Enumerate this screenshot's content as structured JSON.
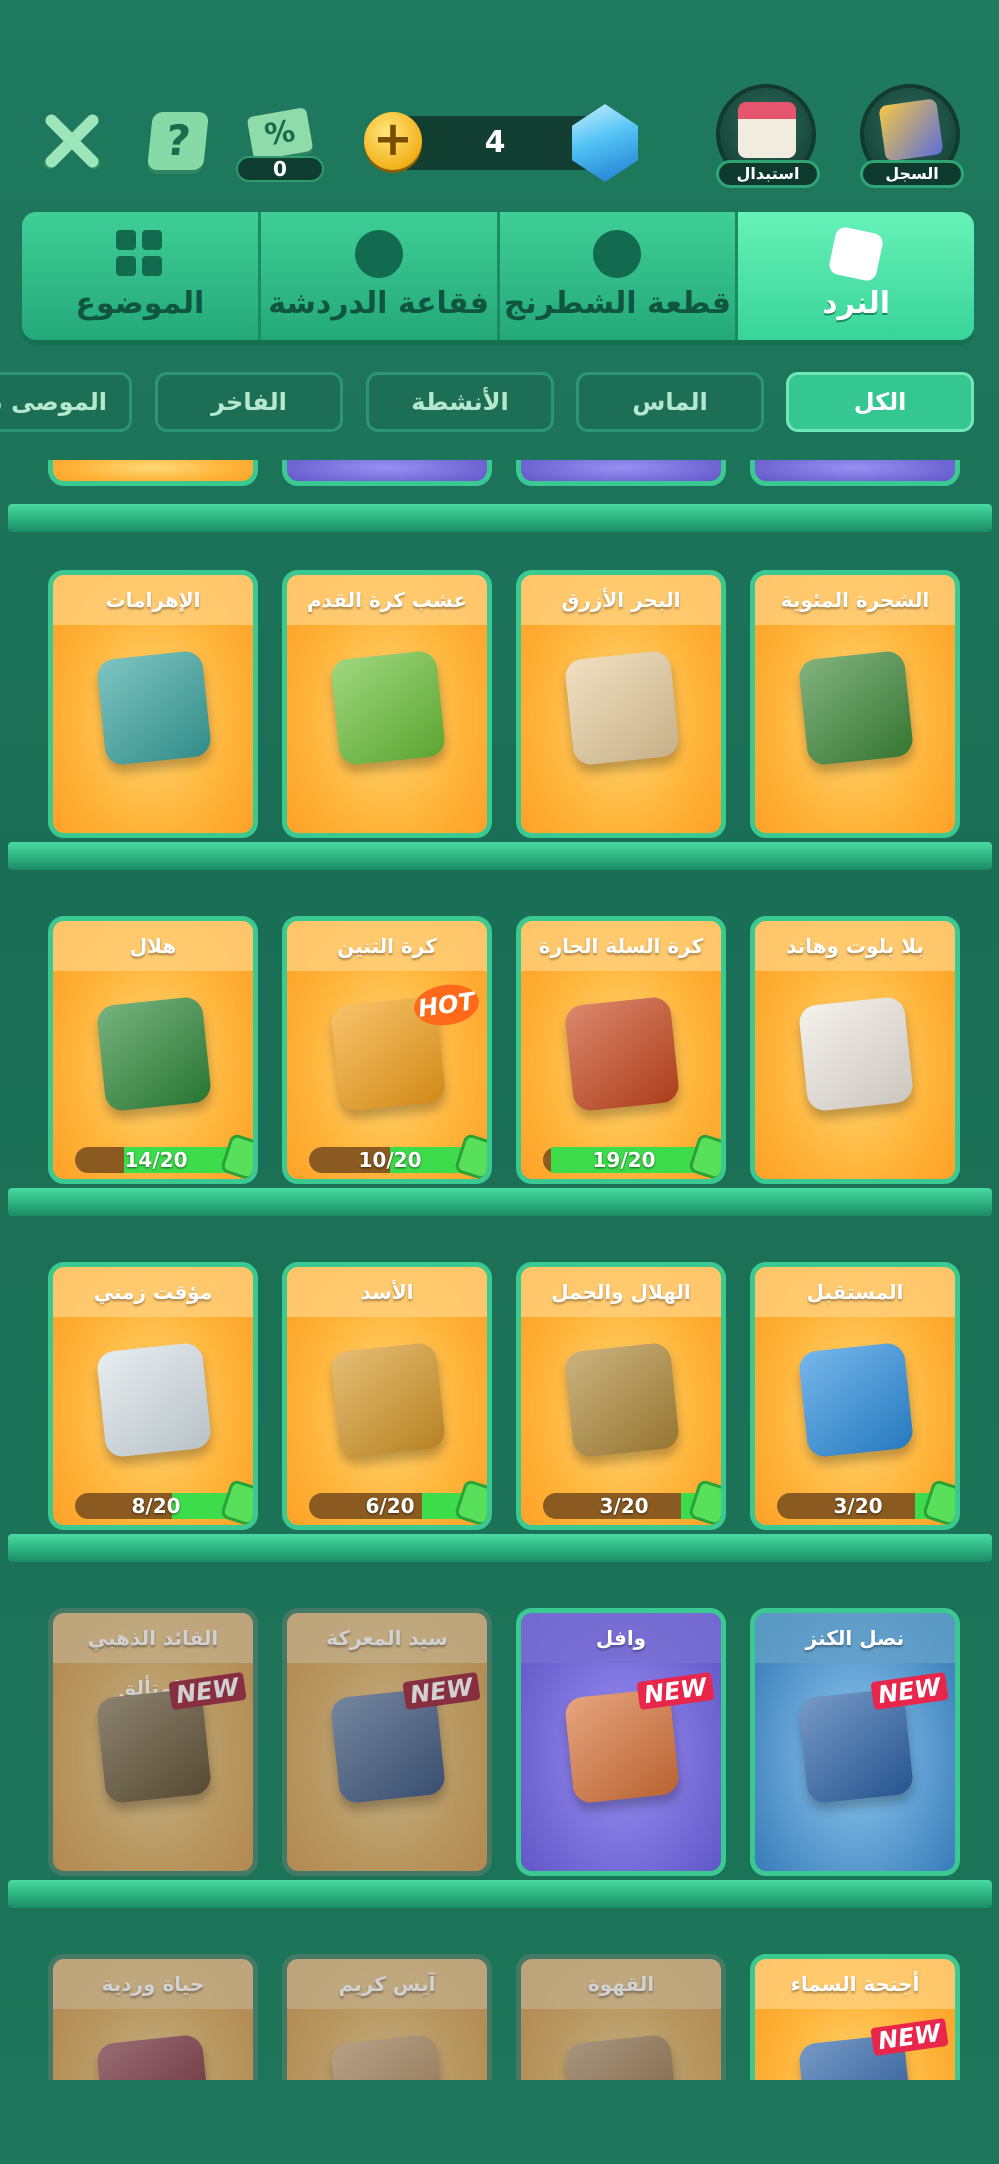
{
  "header": {
    "coupon_count": "0",
    "coupon_symbol": "%",
    "help_symbol": "?",
    "plus_symbol": "+",
    "gem_count": "4",
    "exchange_label": "استبدال",
    "history_label": "السجل"
  },
  "main_tabs": [
    {
      "label": "الموضوع",
      "icon": "theme-grid-icon"
    },
    {
      "label": "فقاعة الدردشة",
      "icon": "chat-bubble-icon"
    },
    {
      "label": "قطعة الشطرنج",
      "icon": "chess-piece-icon"
    },
    {
      "label": "النرد",
      "icon": "dice-icon",
      "active": true
    }
  ],
  "filters": [
    {
      "label": "الموصى بها"
    },
    {
      "label": "الفاخر"
    },
    {
      "label": "الأنشطة"
    },
    {
      "label": "الماس"
    },
    {
      "label": "الكل",
      "active": true
    }
  ],
  "shelves": [
    {
      "cards": [
        {
          "title": "الإهرامات",
          "dice_color": "#3aa5a0"
        },
        {
          "title": "عشب كرة القدم",
          "dice_color": "#6cc23a"
        },
        {
          "title": "البحر الأزرق",
          "dice_color": "#e9cfa0"
        },
        {
          "title": "الشجرة المئوية",
          "dice_color": "#3f8a3a"
        }
      ]
    },
    {
      "cards": [
        {
          "title": "هلال",
          "dice_color": "#2f8a3a",
          "progress_text": "14/20",
          "progress": 0.7
        },
        {
          "title": "كرة التنين",
          "dice_color": "#f5a21c",
          "badge": "HOT",
          "progress_text": "10/20",
          "progress": 0.5
        },
        {
          "title": "كرة السلة الحارة",
          "dice_color": "#c9481f",
          "progress_text": "19/20",
          "progress": 0.95
        },
        {
          "title": "بلا بلوت وهاند",
          "dice_color": "#efe9e0"
        }
      ]
    },
    {
      "cards": [
        {
          "title": "مؤقت زمني",
          "dice_color": "#d9e4ea",
          "progress_text": "8/20",
          "progress": 0.4
        },
        {
          "title": "الأسد",
          "dice_color": "#d79a2a",
          "progress_text": "6/20",
          "progress": 0.3
        },
        {
          "title": "الهلال والجمل",
          "dice_color": "#b08a3a",
          "progress_text": "3/20",
          "progress": 0.15
        },
        {
          "title": "المستقبل",
          "dice_color": "#2d8fe0",
          "progress_text": "3/20",
          "progress": 0.15
        }
      ]
    },
    {
      "cards": [
        {
          "title": "القائد الذهبي المتألق",
          "dice_color": "#8a6a2a",
          "badge": "NEW",
          "dim": true
        },
        {
          "title": "سيد المعركة",
          "dice_color": "#3c74c9",
          "badge": "NEW",
          "dim": true
        },
        {
          "title": "وافل",
          "dice_color": "#d9743a",
          "badge": "NEW",
          "style": "purple"
        },
        {
          "title": "نصل الكنز",
          "dice_color": "#2d63a8",
          "badge": "NEW",
          "style": "blue"
        }
      ]
    },
    {
      "cards": [
        {
          "title": "حياة وردية",
          "dice_color": "#c7324a",
          "dim": true
        },
        {
          "title": "آيس كريم",
          "dice_color": "#e8a04a",
          "dim": true
        },
        {
          "title": "القهوة",
          "dice_color": "#c98a3a",
          "dim": true
        },
        {
          "title": "أجنحة السماء",
          "dice_color": "#2d63a8",
          "badge": "NEW"
        }
      ]
    }
  ]
}
